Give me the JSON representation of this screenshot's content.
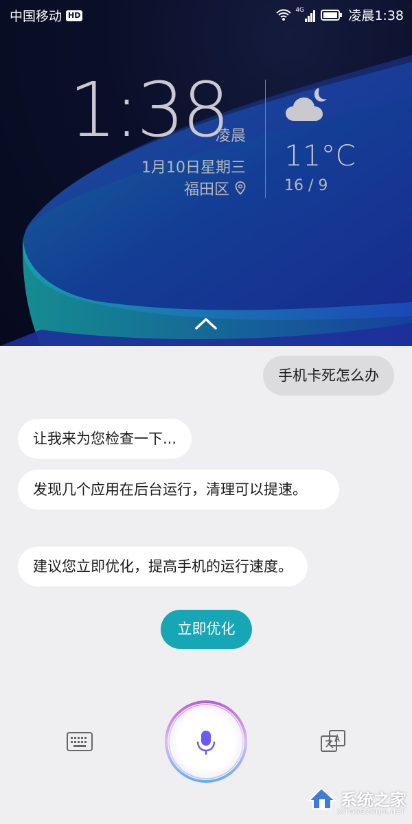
{
  "status_bar": {
    "carrier": "中国移动",
    "hd_badge": "HD",
    "network": "4G",
    "time": "凌晨1:38"
  },
  "lock_screen": {
    "clock": "1:38",
    "ampm": "凌晨",
    "date": "1月10日星期三",
    "location": "福田区",
    "weather": {
      "icon": "cloudy-night-icon",
      "temperature": "11°C",
      "range": "16 / 9"
    }
  },
  "chat": {
    "user_message": "手机卡死怎么办",
    "assistant_messages": [
      "让我来为您检查一下...",
      "发现几个应用在后台运行，清理可以提速。",
      "建议您立即优化，提高手机的运行速度。"
    ],
    "action_button": "立即优化"
  },
  "bottom_bar": {
    "keyboard_icon": "keyboard-icon",
    "mic_icon": "microphone-icon",
    "translate_icon": "translate-icon"
  },
  "watermark": {
    "text": "系统之家",
    "sub": "XITONGZHIJIA.NET"
  },
  "colors": {
    "accent": "#16a6b5",
    "chat_bg": "#efeff1",
    "user_bubble": "#dcdcde",
    "assistant_bubble": "#ffffff"
  }
}
